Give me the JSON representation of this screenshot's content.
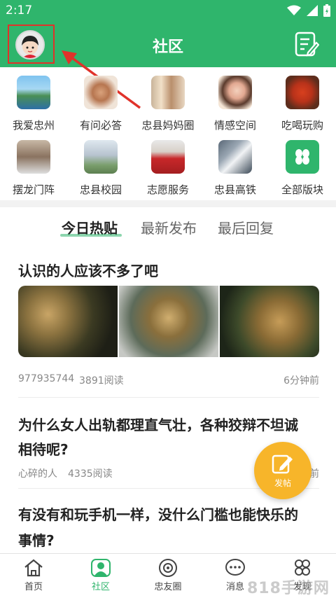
{
  "status_bar": {
    "time": "2:17"
  },
  "header": {
    "title": "社区"
  },
  "grid": {
    "row1": [
      "我爱忠州",
      "有问必答",
      "忠县妈妈圈",
      "情感空间",
      "吃喝玩购"
    ],
    "row2": [
      "摆龙门阵",
      "忠县校园",
      "志愿服务",
      "忠县高铁",
      "全部版块"
    ]
  },
  "tabs": [
    "今日热贴",
    "最新发布",
    "最后回复"
  ],
  "posts": [
    {
      "title": "认识的人应该不多了吧",
      "author": "977935744",
      "reads": "3891阅读",
      "time": "6分钟前"
    },
    {
      "title_line1": "为什么女人出轨都理直气壮，各种狡辩不坦诚",
      "title_line2": "相待呢?",
      "author": "心碎的人",
      "reads": "4335阅读",
      "time": "前"
    },
    {
      "title_line1": "有没有和玩手机一样，没什么门槛也能快乐的",
      "title_line2": "事情?"
    }
  ],
  "fab": {
    "label": "发帖"
  },
  "bottom_nav": [
    "首页",
    "社区",
    "忠友圈",
    "消息",
    "发现"
  ],
  "watermark": "818手游网",
  "colors": {
    "brand_green": "#2fb56c",
    "fab_orange": "#f7b52a",
    "annotation_red": "#e0322a"
  }
}
